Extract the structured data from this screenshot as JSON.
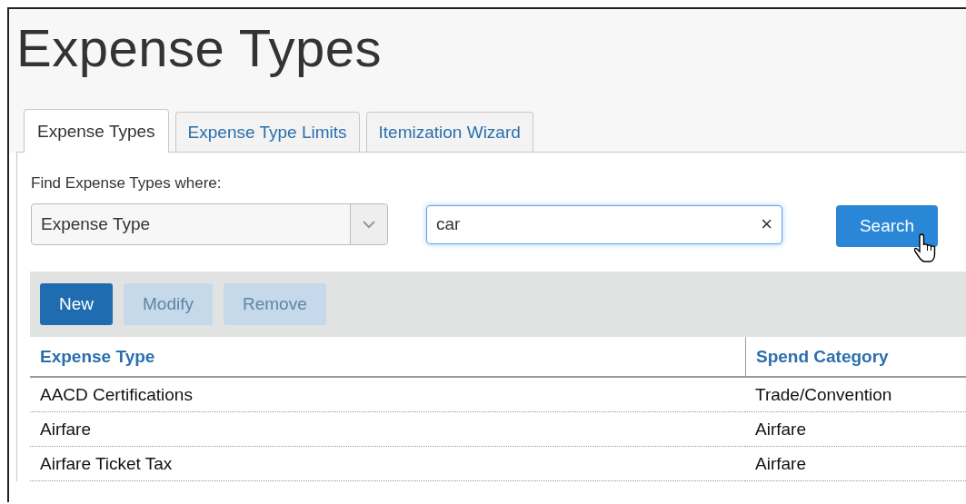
{
  "page_title": "Expense Types",
  "tabs": [
    {
      "label": "Expense Types",
      "selected": true
    },
    {
      "label": "Expense Type Limits",
      "selected": false
    },
    {
      "label": "Itemization Wizard",
      "selected": false
    }
  ],
  "search": {
    "label": "Find Expense Types where:",
    "field": "Expense Type",
    "value": "car",
    "clear": "×",
    "button": "Search"
  },
  "toolbar": [
    {
      "label": "New",
      "disabled": false
    },
    {
      "label": "Modify",
      "disabled": true
    },
    {
      "label": "Remove",
      "disabled": true
    }
  ],
  "table": {
    "columns": [
      "Expense Type",
      "Spend Category"
    ],
    "rows": [
      [
        "AACD Certifications",
        "Trade/Convention"
      ],
      [
        "Airfare",
        "Airfare"
      ],
      [
        "Airfare Ticket Tax",
        "Airfare"
      ]
    ]
  }
}
